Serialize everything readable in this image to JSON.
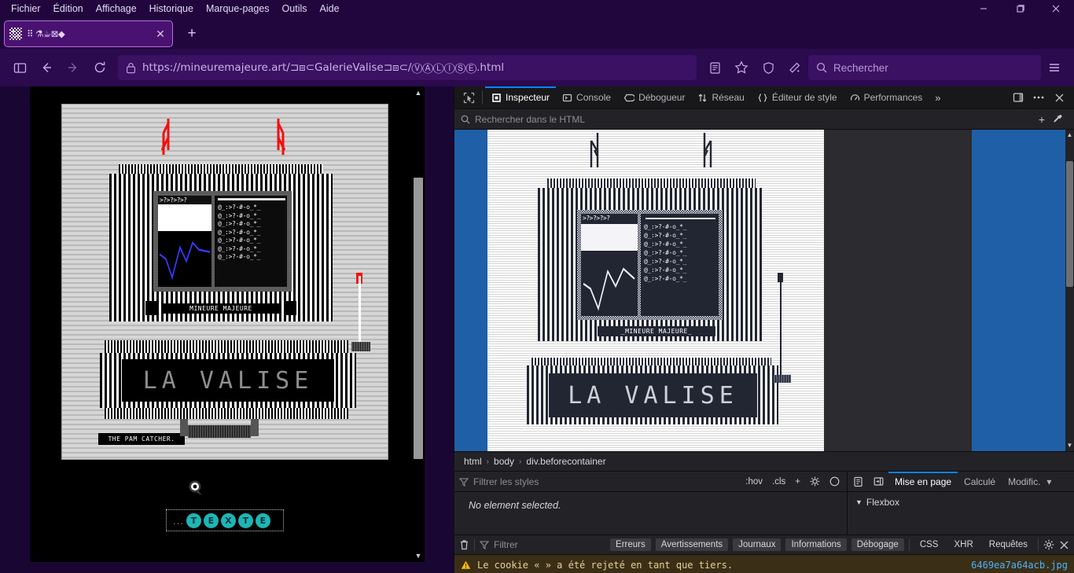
{
  "browser": {
    "menus": [
      "Fichier",
      "Édition",
      "Affichage",
      "Historique",
      "Marque-pages",
      "Outils",
      "Aide"
    ],
    "window_controls": [
      "minimize-icon",
      "restore-icon",
      "close-icon"
    ],
    "tab": {
      "title": "⠿ ⚗☕⊠◆",
      "favicon": "pixel-art-favicon",
      "close_label": "✕"
    },
    "newtab_label": "+",
    "nav": {
      "sidebar_icon": "sidebar-icon",
      "back_icon": "back-arrow-icon",
      "forward_icon": "forward-arrow-icon",
      "reload_icon": "reload-icon",
      "lock_icon": "padlock-icon",
      "url_prefix": "https://",
      "url_domain": "mineuremajeure.art",
      "url_rest": "/⊐⧈⊂GalerieValise⊐⧈⊂/ⓋⒶⓁⒾⓈⒺ.html",
      "url_full": "https://mineuremajeure.art/⊐⧈⊂GalerieValise⊐⧈⊂/ⓋⒶⓁⒾⓈⒺ.html",
      "reader_icon": "reader-mode-icon",
      "bookmark_icon": "star-icon",
      "shield_icon": "shield-icon",
      "sparkle_icon": "sparkle-icon",
      "menu_icon": "hamburger-menu-icon"
    },
    "search": {
      "icon": "search-icon",
      "placeholder": "Rechercher"
    }
  },
  "page": {
    "scrollbar": {
      "up": "▲",
      "down": "▼"
    },
    "artwork": {
      "caret_line": ">?>?>?>?",
      "data_rows": [
        "@_:>?-#-o_*_",
        "@_:>?-#-o_*_",
        "@_:>?-#-o_*_",
        "@_:>?-#-o_*_",
        "@_:>?-#-o_*_",
        "@_:>?-#-o_*_",
        "@_:>?-#-o_*_"
      ],
      "machine_label": "MINEURE MAJEURE",
      "title_display": "LA VALISE",
      "footer_label": "THE PAM CATCHER."
    },
    "zoom_cursor_icon": "magnifier-cursor-icon",
    "texte_widget": {
      "prefix": "...",
      "letters": [
        "T",
        "E",
        "X",
        "T",
        "E"
      ],
      "chip_color": "#1fb5b5"
    }
  },
  "devtools": {
    "picker_icon": "element-picker-icon",
    "tabs": [
      {
        "label": "Inspecteur",
        "icon": "inspector-icon",
        "active": true
      },
      {
        "label": "Console",
        "icon": "console-icon",
        "active": false
      },
      {
        "label": "Débogueur",
        "icon": "debugger-icon",
        "active": false
      },
      {
        "label": "Réseau",
        "icon": "network-icon",
        "active": false
      },
      {
        "label": "Éditeur de style",
        "icon": "style-editor-icon",
        "active": false
      },
      {
        "label": "Performances",
        "icon": "performance-icon",
        "active": false
      }
    ],
    "overflow_label": "»",
    "dock_icon": "dock-panel-icon",
    "more_icon": "more-options-icon",
    "close_icon": "close-devtools-icon",
    "html_search": {
      "icon": "search-icon",
      "placeholder": "Rechercher dans le HTML",
      "add_label": "+",
      "eyedropper_icon": "eyedropper-icon"
    },
    "viewport": {
      "caret_line": ">?>?>?>?",
      "data_rows": [
        "@_:>?-#-o_*_",
        "@_:>?-#-o_*_",
        "@_:>?-#-o_*_",
        "@_:>?-#-o_*_",
        "@_:>?-#-o_*_",
        "@_:>?-#-o_*_",
        "@_:>?-#-o_*_"
      ],
      "machine_label": "_MINEURE MAJEURE_",
      "title_display": "LA VALISE",
      "highlight_color": "#1f5fa8"
    },
    "breadcrumb": [
      "html",
      "body",
      "div.beforecontainer"
    ],
    "breadcrumb_sep": "›",
    "rules": {
      "filter_placeholder": "Filtrer les styles",
      "hov_label": ":hov",
      "cls_label": ".cls",
      "add_label": "+",
      "light_icon": "sun-icon",
      "dark_icon": "moon-icon",
      "print_icon": "print-media-icon",
      "empty_message": "No element selected."
    },
    "layout": {
      "toggle_icon": "panel-toggle-icon",
      "tabs": [
        {
          "label": "Mise en page",
          "active": true
        },
        {
          "label": "Calculé",
          "active": false
        },
        {
          "label": "Modific.",
          "active": false
        }
      ],
      "dropdown_icon": "chevron-down-icon",
      "section": {
        "caret": "▼",
        "label": "Flexbox"
      }
    },
    "console": {
      "trash_icon": "trash-icon",
      "filter_icon": "filter-icon",
      "filter_placeholder": "Filtrer",
      "buttons": [
        "Erreurs",
        "Avertissements",
        "Journaux",
        "Informations",
        "Débogage"
      ],
      "plain_buttons": [
        "CSS",
        "XHR",
        "Requêtes"
      ],
      "settings_icon": "gear-icon",
      "close_icon": "close-icon",
      "message": {
        "warn_icon": "warning-icon",
        "text": "Le cookie «  » a été rejeté en tant que tiers.",
        "source": "6469ea7a64acb.jpg"
      }
    }
  },
  "colors": {
    "browser_chrome": "#20063c",
    "nav_bg": "#2b0a4d",
    "tab_active": "#4a1270",
    "tab_border": "#b86fe0",
    "devtools_bg": "#232327",
    "devtools_toolbar": "#18181a",
    "accent_blue": "#0a84ff",
    "warn_bg": "#3a2f16",
    "link_blue": "#4db2ff"
  }
}
